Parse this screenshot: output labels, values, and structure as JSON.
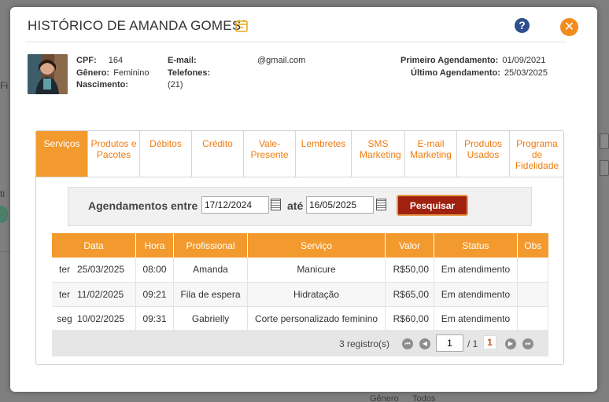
{
  "background": {
    "frag_fi": "Fi",
    "frag_ti": "ti",
    "frag_genero": "Gênero",
    "frag_todos": "Todos"
  },
  "modal": {
    "title": "HISTÓRICO DE AMANDA GOMES",
    "help_glyph": "?",
    "close_glyph": "✕"
  },
  "client": {
    "cpf_label": "CPF:",
    "cpf_value": "164",
    "genero_label": "Gênero:",
    "genero_value": "Feminino",
    "nascimento_label": "Nascimento:",
    "email_label": "E-mail:",
    "email_value": "@gmail.com",
    "telefones_label": "Telefones:",
    "telefones_value": "(21)",
    "primeiro_label": "Primeiro Agendamento:",
    "primeiro_value": "01/09/2021",
    "ultimo_label": "Último Agendamento:",
    "ultimo_value": "25/03/2025"
  },
  "tabs": [
    {
      "label": "Serviços"
    },
    {
      "label": "Produtos e Pacotes"
    },
    {
      "label": "Débitos"
    },
    {
      "label": "Crédito"
    },
    {
      "label": "Vale-Presente"
    },
    {
      "label": "Lembretes"
    },
    {
      "label": "SMS Marketing"
    },
    {
      "label": "E-mail Marketing"
    },
    {
      "label": "Produtos Usados"
    },
    {
      "label": "Programa de Fidelidade"
    }
  ],
  "search": {
    "label_between": "Agendamentos entre",
    "date_from": "17/12/2024",
    "label_until": "até",
    "date_to": "16/05/2025",
    "button": "Pesquisar"
  },
  "table": {
    "headers": [
      "Data",
      "Hora",
      "Profissional",
      "Serviço",
      "Valor",
      "Status",
      "Obs"
    ],
    "rows": [
      {
        "dow": "ter",
        "date": "25/03/2025",
        "time": "08:00",
        "professional": "Amanda",
        "service": "Manicure",
        "value": "R$50,00",
        "status": "Em atendimento",
        "obs": ""
      },
      {
        "dow": "ter",
        "date": "11/02/2025",
        "time": "09:21",
        "professional": "Fila de espera",
        "service": "Hidratação",
        "value": "R$65,00",
        "status": "Em atendimento",
        "obs": ""
      },
      {
        "dow": "seg",
        "date": "10/02/2025",
        "time": "09:31",
        "professional": "Gabrielly",
        "service": "Corte personalizado feminino",
        "value": "R$60,00",
        "status": "Em atendimento",
        "obs": ""
      }
    ]
  },
  "pager": {
    "records": "3 registro(s)",
    "page_value": "1",
    "of_total": "/ 1",
    "current": "1"
  },
  "colors": {
    "accent": "#f39a2e",
    "tab_text": "#f07c0f",
    "search_button": "#a0210f",
    "close": "#f28c1e",
    "help": "#2d4f8e"
  }
}
